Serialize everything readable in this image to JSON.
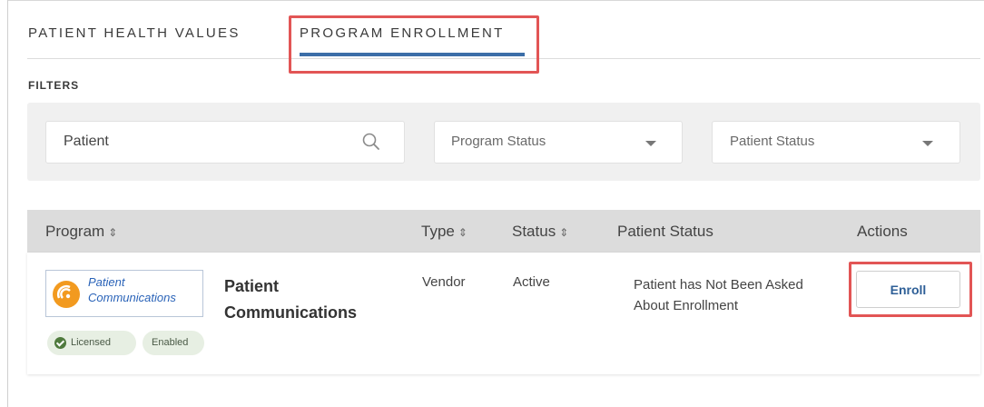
{
  "tabs": [
    {
      "label": "PATIENT HEALTH VALUES"
    },
    {
      "label": "PROGRAM ENROLLMENT"
    }
  ],
  "filters": {
    "label": "FILTERS",
    "search": {
      "value": "Patient",
      "icon": "search-icon"
    },
    "program_status": {
      "placeholder": "Program Status"
    },
    "patient_status": {
      "placeholder": "Patient Status"
    }
  },
  "table": {
    "headers": {
      "program": "Program",
      "type": "Type",
      "status": "Status",
      "patient_status": "Patient Status",
      "actions": "Actions",
      "sort_glyph": "⇕"
    },
    "rows": [
      {
        "logo": {
          "line1": "Patient",
          "line2": "Communications"
        },
        "badges": [
          "Licensed",
          "Enabled"
        ],
        "program": "Patient Communications",
        "type": "Vendor",
        "status": "Active",
        "patient_status": "Patient has Not Been Asked About Enrollment",
        "action": "Enroll"
      }
    ]
  },
  "colors": {
    "accent": "#3c6ea8",
    "highlight": "#e25555",
    "badge_bg": "#e7efe3",
    "logo_orange": "#f29a1f",
    "logo_blue": "#2a63b8"
  }
}
